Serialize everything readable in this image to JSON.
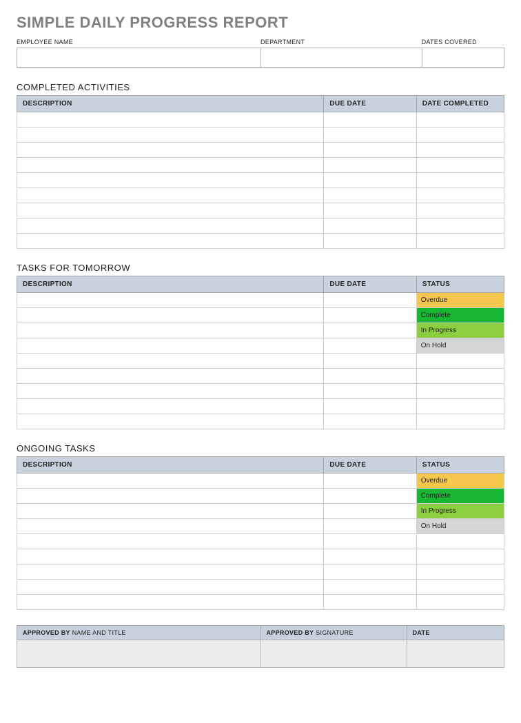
{
  "title": "SIMPLE DAILY PROGRESS REPORT",
  "top": {
    "employee_label": "EMPLOYEE NAME",
    "department_label": "DEPARTMENT",
    "dates_label": "DATES COVERED",
    "employee_value": "",
    "department_value": "",
    "dates_value": ""
  },
  "completed": {
    "heading": "COMPLETED ACTIVITIES",
    "col_description": "DESCRIPTION",
    "col_due": "DUE DATE",
    "col_completed": "DATE COMPLETED",
    "rows": [
      {
        "description": "",
        "due": "",
        "completed": ""
      },
      {
        "description": "",
        "due": "",
        "completed": ""
      },
      {
        "description": "",
        "due": "",
        "completed": ""
      },
      {
        "description": "",
        "due": "",
        "completed": ""
      },
      {
        "description": "",
        "due": "",
        "completed": ""
      },
      {
        "description": "",
        "due": "",
        "completed": ""
      },
      {
        "description": "",
        "due": "",
        "completed": ""
      },
      {
        "description": "",
        "due": "",
        "completed": ""
      },
      {
        "description": "",
        "due": "",
        "completed": ""
      }
    ]
  },
  "tomorrow": {
    "heading": "TASKS FOR TOMORROW",
    "col_description": "DESCRIPTION",
    "col_due": "DUE DATE",
    "col_status": "STATUS",
    "rows": [
      {
        "description": "",
        "due": "",
        "status": "Overdue",
        "status_class": "status-overdue"
      },
      {
        "description": "",
        "due": "",
        "status": "Complete",
        "status_class": "status-complete"
      },
      {
        "description": "",
        "due": "",
        "status": "In Progress",
        "status_class": "status-inprogress"
      },
      {
        "description": "",
        "due": "",
        "status": "On Hold",
        "status_class": "status-onhold"
      },
      {
        "description": "",
        "due": "",
        "status": "",
        "status_class": ""
      },
      {
        "description": "",
        "due": "",
        "status": "",
        "status_class": ""
      },
      {
        "description": "",
        "due": "",
        "status": "",
        "status_class": ""
      },
      {
        "description": "",
        "due": "",
        "status": "",
        "status_class": ""
      },
      {
        "description": "",
        "due": "",
        "status": "",
        "status_class": ""
      }
    ]
  },
  "ongoing": {
    "heading": "ONGOING TASKS",
    "col_description": "DESCRIPTION",
    "col_due": "DUE DATE",
    "col_status": "STATUS",
    "rows": [
      {
        "description": "",
        "due": "",
        "status": "Overdue",
        "status_class": "status-overdue"
      },
      {
        "description": "",
        "due": "",
        "status": "Complete",
        "status_class": "status-complete"
      },
      {
        "description": "",
        "due": "",
        "status": "In Progress",
        "status_class": "status-inprogress"
      },
      {
        "description": "",
        "due": "",
        "status": "On Hold",
        "status_class": "status-onhold"
      },
      {
        "description": "",
        "due": "",
        "status": "",
        "status_class": ""
      },
      {
        "description": "",
        "due": "",
        "status": "",
        "status_class": ""
      },
      {
        "description": "",
        "due": "",
        "status": "",
        "status_class": ""
      },
      {
        "description": "",
        "due": "",
        "status": "",
        "status_class": ""
      },
      {
        "description": "",
        "due": "",
        "status": "",
        "status_class": ""
      }
    ]
  },
  "approval": {
    "col_a_bold": "APPROVED BY",
    "col_a_rest": " NAME AND TITLE",
    "col_b_bold": "APPROVED BY",
    "col_b_rest": " SIGNATURE",
    "col_c_bold": "DATE",
    "col_c_rest": "",
    "val_a": "",
    "val_b": "",
    "val_c": ""
  }
}
